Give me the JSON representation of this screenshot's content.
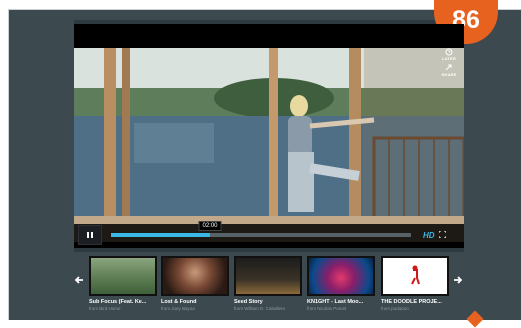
{
  "badge": {
    "number": "86"
  },
  "player": {
    "side_icons": [
      {
        "icon": "clock-icon",
        "label": "LATER"
      },
      {
        "icon": "share-icon",
        "label": "SHARE"
      }
    ],
    "timecode": "02:00",
    "progress_fraction": 0.33,
    "hd_label": "HD"
  },
  "thumbnails": [
    {
      "title": "Sub Focus (Feat. Ke...",
      "by": "from Bird Home"
    },
    {
      "title": "Lost & Found",
      "by": "from Joey Bayua"
    },
    {
      "title": "Seed Story",
      "by": "from William D. Caballero"
    },
    {
      "title": "KN1GHT - Last Moo...",
      "by": "from Nicolas Pomet"
    },
    {
      "title": "THE DOODLE PROJE...",
      "by": "from podopoo"
    }
  ],
  "colors": {
    "accent": "#3bb7e6",
    "badge": "#e8621f",
    "background": "#3c4a50"
  }
}
